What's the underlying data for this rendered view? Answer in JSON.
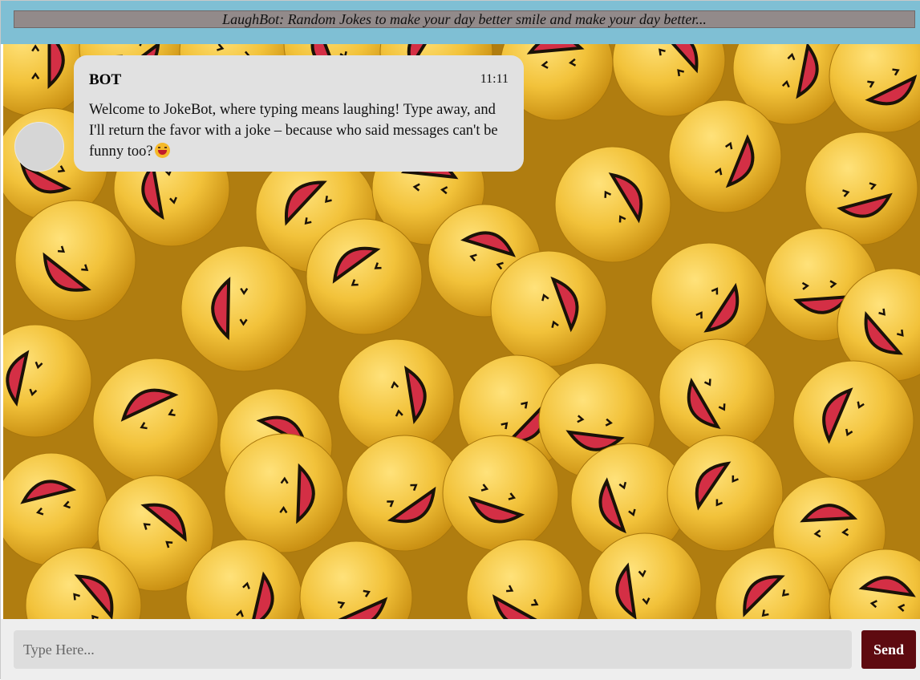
{
  "header": {
    "marquee_text": "LaughBot: Random Jokes to make your day better smile and make your day better..."
  },
  "messages": [
    {
      "sender": "BOT",
      "time": "11:11",
      "text": "Welcome to JokeBot, where typing means laughing! Type away, and I'll return the favor with a joke – because who said messages can't be funny too?",
      "trailing_icon": "laughing-emoji-icon"
    }
  ],
  "composer": {
    "placeholder": "Type Here...",
    "value": "",
    "send_label": "Send"
  },
  "colors": {
    "header_bg": "#7fbfd4",
    "marquee_bg": "#928a8a",
    "bubble_bg": "#e1e1e1",
    "send_bg": "#5e0a10",
    "emoji_yellow": "#f2c23a",
    "emoji_mouth": "#d42f45"
  },
  "background": {
    "description_icon": "laughing-emoji-balls-background"
  }
}
